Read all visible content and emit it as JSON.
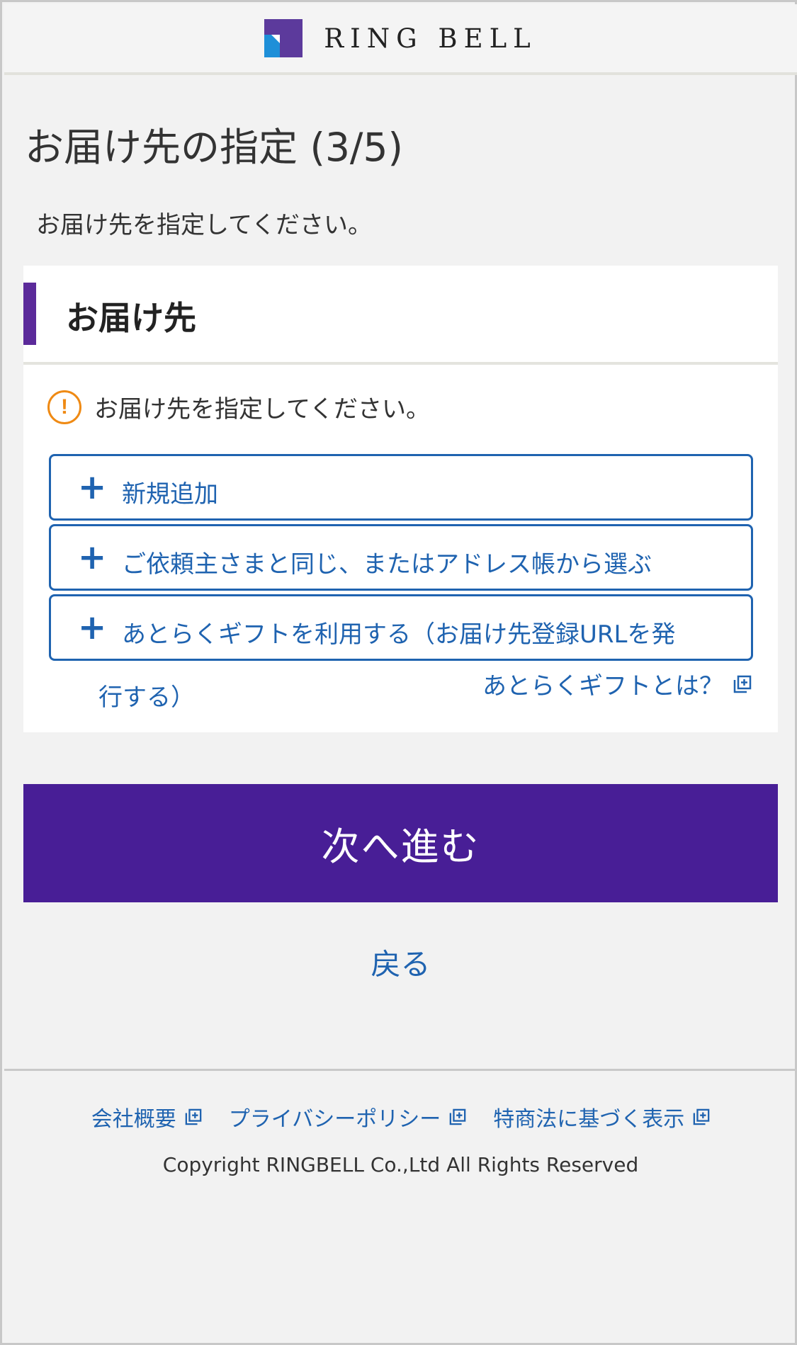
{
  "header": {
    "logo_text": "RING BELL"
  },
  "page": {
    "title": "お届け先の指定 (3/5)",
    "intro": "お届け先を指定してください。"
  },
  "card": {
    "heading": "お届け先",
    "notice": "お届け先を指定してください。",
    "options": [
      {
        "label": "新規追加"
      },
      {
        "label": "ご依頼主さまと同じ、またはアドレス帳から選ぶ"
      },
      {
        "label": "あとらくギフトを利用する（お届け先登録URLを発",
        "label_wrap": "行する）"
      }
    ],
    "gift_info_link": "あとらくギフトとは？"
  },
  "actions": {
    "next_label": "次へ進む",
    "back_label": "戻る"
  },
  "footer": {
    "links": [
      "会社概要",
      "プライバシーポリシー",
      "特商法に基づく表示"
    ],
    "copyright": "Copyright RINGBELL Co.,Ltd All Rights Reserved"
  },
  "colors": {
    "brand_purple": "#481e96",
    "link_blue": "#1f63b0",
    "warning_orange": "#ef8a14"
  },
  "icons": [
    "logo-mark",
    "warning-icon",
    "plus-icon",
    "external-link-icon"
  ]
}
